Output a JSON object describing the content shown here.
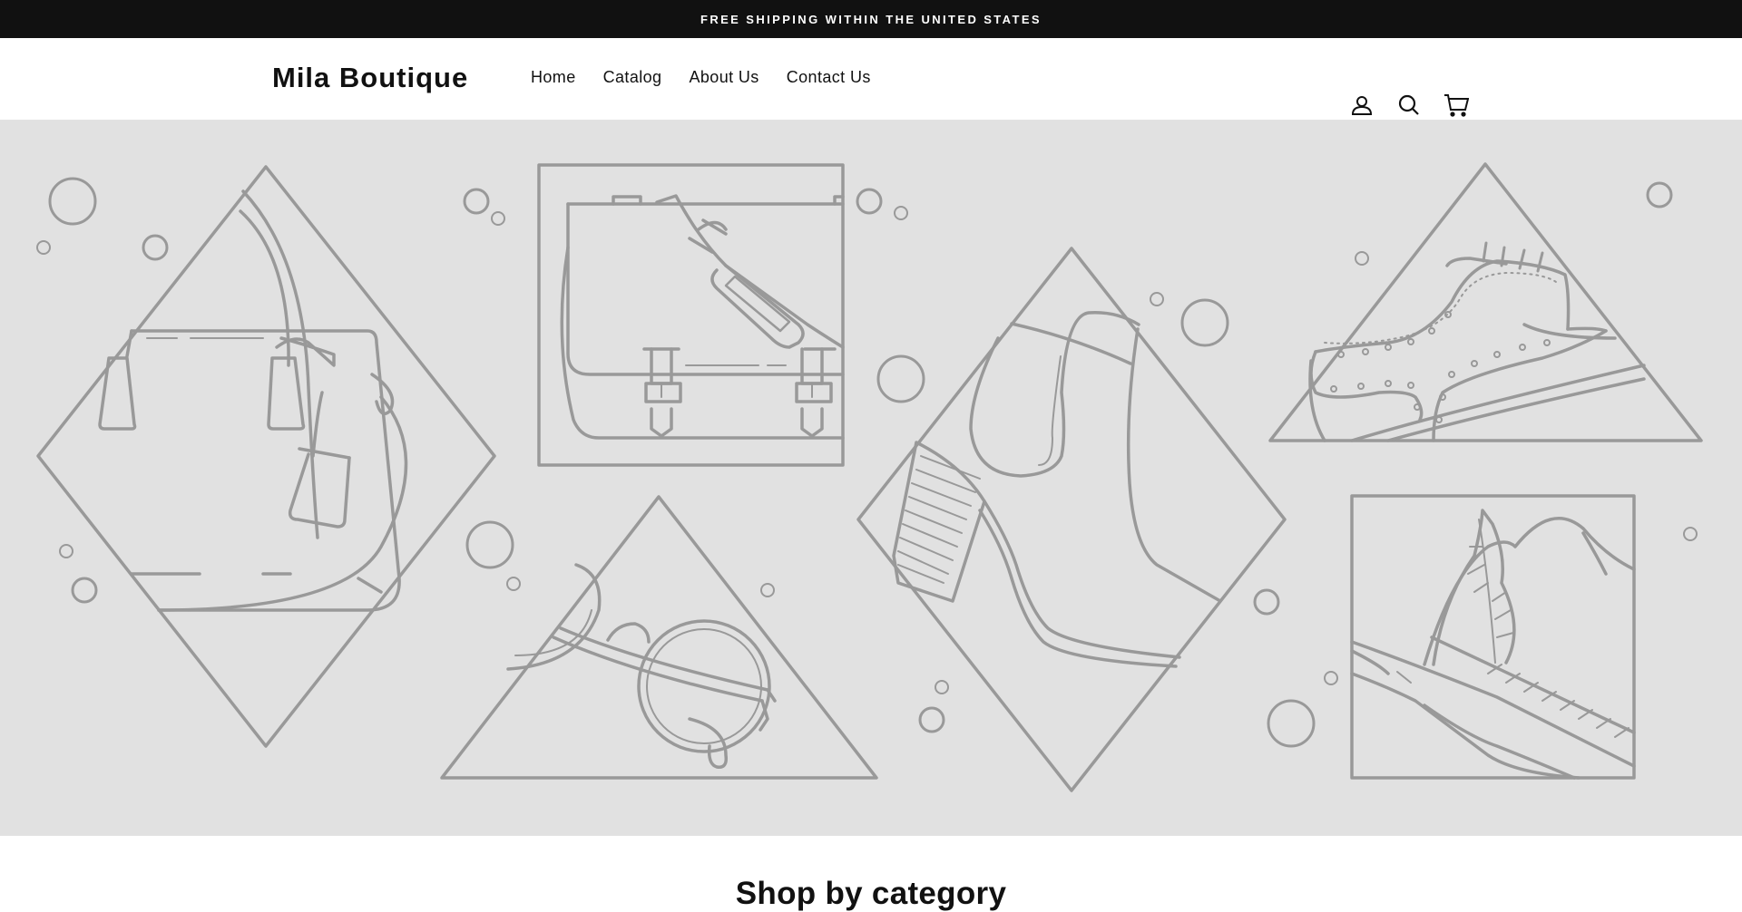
{
  "announcement": {
    "text": "FREE SHIPPING WITHIN THE UNITED STATES"
  },
  "header": {
    "logo": "Mila Boutique",
    "nav": [
      {
        "label": "Home"
      },
      {
        "label": "Catalog"
      },
      {
        "label": "About Us"
      },
      {
        "label": "Contact Us"
      }
    ],
    "icons": [
      "account-icon",
      "search-icon",
      "cart-icon"
    ]
  },
  "hero": {
    "illustration": [
      "handbag",
      "messenger-bag",
      "sunglasses",
      "ankle-boot",
      "brogue-shoe",
      "feather-hat"
    ],
    "background_color": "#e1e1e1",
    "line_color": "#999999"
  },
  "sections": {
    "category_title": "Shop by category"
  }
}
